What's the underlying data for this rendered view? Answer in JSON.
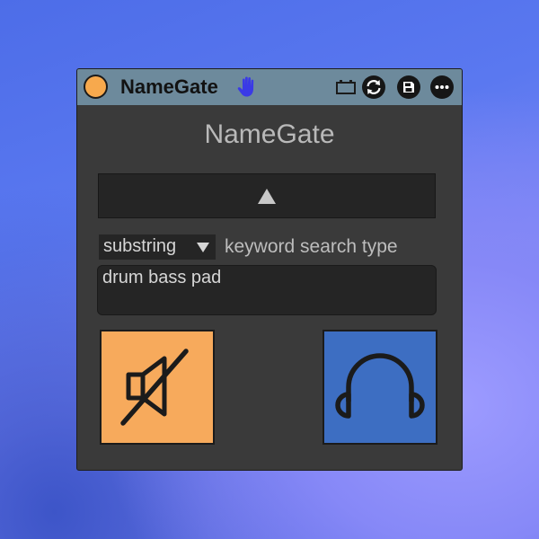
{
  "device": {
    "name": "NameGate",
    "title": "NameGate",
    "colors": {
      "power": "#f7a94d",
      "titlebar": "#6d8a9c",
      "mute": "#f7aa5c",
      "solo": "#3d6ec2",
      "hand": "#3a3ae6"
    }
  },
  "titlebar": {
    "icons": [
      "power-icon",
      "hand-icon",
      "battery-icon",
      "sync-icon",
      "save-icon",
      "more-icon"
    ]
  },
  "controls": {
    "search_type_value": "substring",
    "search_type_label": "keyword search type",
    "keywords": "drum bass pad"
  },
  "buttons": {
    "mute_icon": "speaker-muted-icon",
    "solo_icon": "headphones-icon"
  }
}
